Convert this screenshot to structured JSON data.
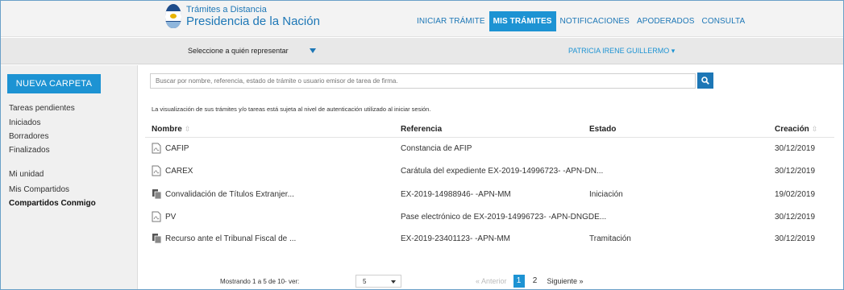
{
  "brand": {
    "line1": "Trámites a Distancia",
    "line2": "Presidencia de la Nación"
  },
  "nav": [
    {
      "label": "INICIAR TRÁMITE",
      "active": false
    },
    {
      "label": "MIS TRÁMITES",
      "active": true
    },
    {
      "label": "NOTIFICACIONES",
      "active": false
    },
    {
      "label": "APODERADOS",
      "active": false
    },
    {
      "label": "CONSULTA",
      "active": false
    }
  ],
  "subbar": {
    "represent_label": "Seleccione a quién representar",
    "user_label": "PATRICIA IRENE GUILLERMO ▾"
  },
  "sidebar": {
    "new_folder_label": "NUEVA CARPETA",
    "items": [
      {
        "label": "Tareas pendientes",
        "bold": false
      },
      {
        "label": "Iniciados",
        "bold": false
      },
      {
        "label": "Borradores",
        "bold": false
      },
      {
        "label": "Finalizados",
        "bold": false
      },
      {
        "label": "Mi unidad",
        "bold": false
      },
      {
        "label": "Mis Compartidos",
        "bold": false
      },
      {
        "label": "Compartidos Conmigo",
        "bold": true
      }
    ]
  },
  "search": {
    "placeholder": "Buscar por nombre, referencia, estado de trámite o usuario emisor de tarea de firma."
  },
  "notice": "La visualización de sus trámites y/o tareas está sujeta al nivel de autenticación utilizado al iniciar sesión.",
  "table": {
    "headers": {
      "name": "Nombre",
      "reference": "Referencia",
      "status": "Estado",
      "created": "Creación"
    },
    "rows": [
      {
        "icon": "pdf-icon",
        "name": "CAFIP",
        "reference": "Constancia de AFIP",
        "status": "",
        "created": "30/12/2019"
      },
      {
        "icon": "pdf-icon",
        "name": "CAREX",
        "reference": "Carátula del expediente EX-2019-14996723- -APN-DN...",
        "status": "",
        "created": "30/12/2019"
      },
      {
        "icon": "copy-icon",
        "name": "Convalidación de Títulos Extranjer...",
        "reference": "EX-2019-14988946- -APN-MM",
        "status": "Iniciación",
        "created": "19/02/2019"
      },
      {
        "icon": "pdf-icon",
        "name": "PV",
        "reference": "Pase electrónico de EX-2019-14996723- -APN-DNGDE...",
        "status": "",
        "created": "30/12/2019"
      },
      {
        "icon": "copy-icon",
        "name": "Recurso ante el Tribunal Fiscal de ...",
        "reference": "EX-2019-23401123- -APN-MM",
        "status": "Tramitación",
        "created": "30/12/2019"
      }
    ]
  },
  "footer": {
    "showing": "Mostrando 1 a 5 de 10- ver:",
    "page_size": "5",
    "prev_label": "« Anterior",
    "pages": [
      "1",
      "2"
    ],
    "current_page": "1",
    "next_label": "Siguiente »"
  },
  "colors": {
    "accent": "#1d93d3",
    "link": "#1d77b6",
    "header_bg": "#f3f3f3",
    "sidebar_bg": "#f0f0f0"
  }
}
